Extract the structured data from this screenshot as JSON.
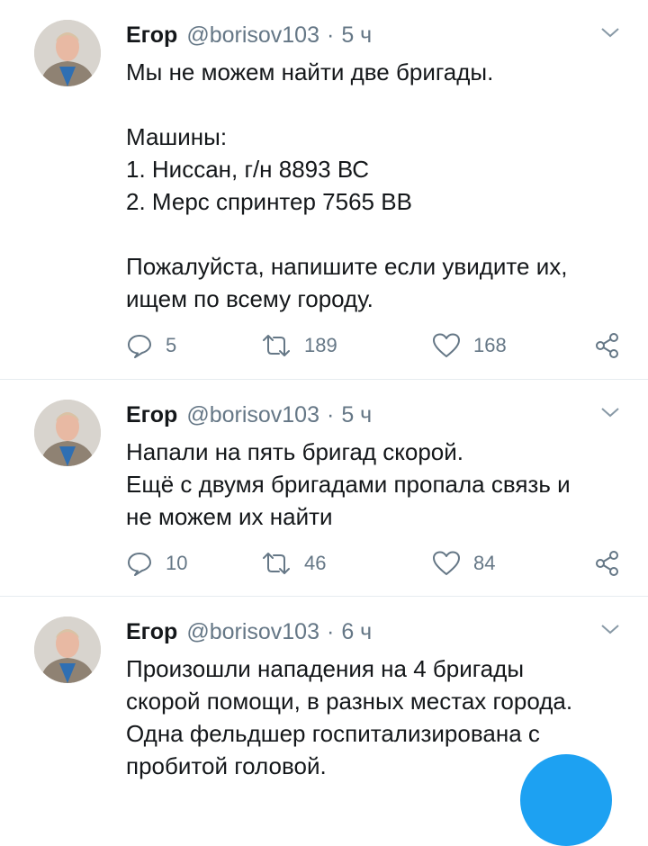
{
  "colors": {
    "accent": "#1da1f2",
    "secondary_text": "#657786",
    "divider": "#e6ecf0"
  },
  "tweets": [
    {
      "name": "Егор",
      "handle": "@borisov103",
      "separator": "·",
      "time": "5 ч",
      "lines": [
        "Мы не можем найти две бригады.",
        "",
        "Машины:",
        "1. Ниссан, г/н 8893 ВС",
        "2. Мерс спринтер 7565 ВВ",
        "",
        "Пожалуйста, напишите если увидите их,",
        "ищем по всему городу."
      ],
      "replies": "5",
      "retweets": "189",
      "likes": "168"
    },
    {
      "name": "Егор",
      "handle": "@borisov103",
      "separator": "·",
      "time": "5 ч",
      "lines": [
        "Напали на пять бригад скорой.",
        "Ещё с двумя бригадами пропала связь и",
        "не можем их найти"
      ],
      "replies": "10",
      "retweets": "46",
      "likes": "84"
    },
    {
      "name": "Егор",
      "handle": "@borisov103",
      "separator": "·",
      "time": "6 ч",
      "lines": [
        "Произошли нападения на 4 бригады",
        "скорой помощи, в разных местах города.",
        "Одна фельдшер госпитализирована с",
        "пробитой головой."
      ]
    }
  ],
  "icons": {
    "caret": "chevron-down-icon",
    "reply": "reply-icon",
    "retweet": "retweet-icon",
    "like": "heart-icon",
    "share": "share-icon",
    "compose": "compose-button"
  }
}
